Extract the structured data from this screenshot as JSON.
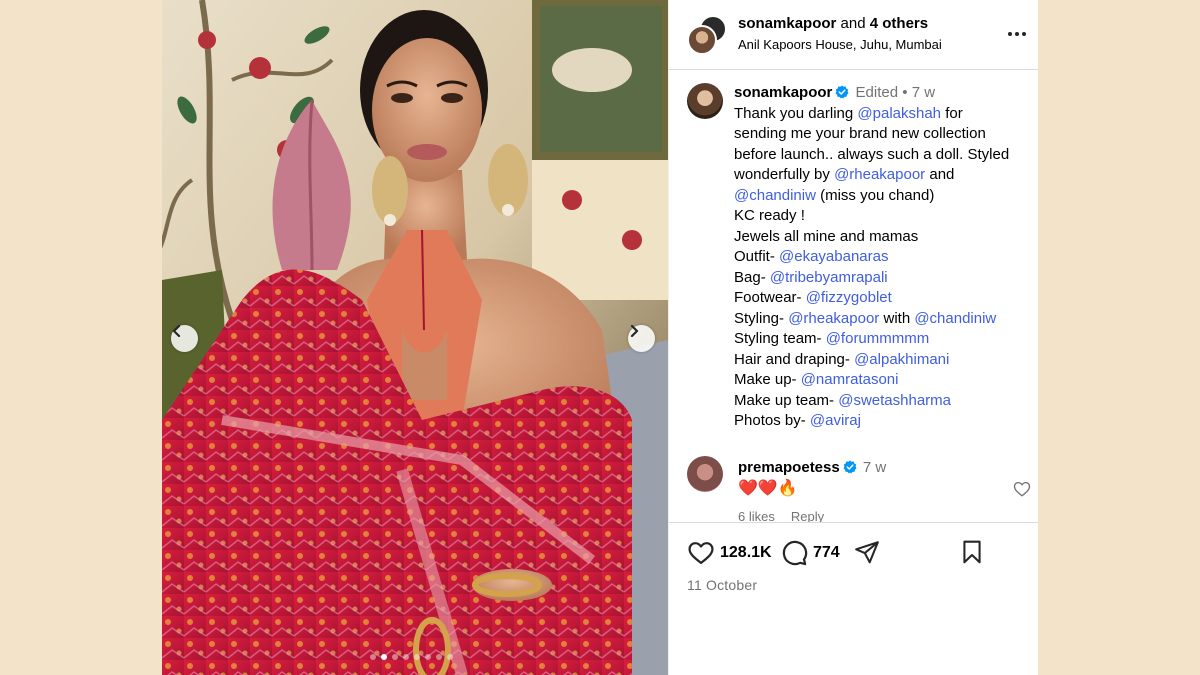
{
  "header": {
    "username": "sonamkapoor",
    "connector": " and ",
    "others": "4 others",
    "location": "Anil Kapoors House, Juhu, Mumbai"
  },
  "caption": {
    "username": "sonamkapoor",
    "edited": "Edited",
    "separator": "•",
    "time": "7 w",
    "lines": [
      [
        {
          "t": "Thank you darling "
        },
        {
          "t": "@palakshah",
          "m": true
        },
        {
          "t": " for"
        }
      ],
      [
        {
          "t": "sending me your brand new collection"
        }
      ],
      [
        {
          "t": "before launch.. always such a doll. Styled"
        }
      ],
      [
        {
          "t": "wonderfully by "
        },
        {
          "t": "@rheakapoor",
          "m": true
        },
        {
          "t": " and"
        }
      ],
      [
        {
          "t": "@chandiniw",
          "m": true
        },
        {
          "t": " (miss you chand)"
        }
      ],
      [
        {
          "t": "KC ready !"
        }
      ],
      [
        {
          "t": "Jewels all mine and mamas"
        }
      ],
      [
        {
          "t": "Outfit- "
        },
        {
          "t": "@ekayabanaras",
          "m": true
        }
      ],
      [
        {
          "t": "Bag- "
        },
        {
          "t": "@tribebyamrapali",
          "m": true
        }
      ],
      [
        {
          "t": "Footwear- "
        },
        {
          "t": "@fizzygoblet",
          "m": true
        }
      ],
      [
        {
          "t": "Styling- "
        },
        {
          "t": "@rheakapoor",
          "m": true
        },
        {
          "t": " with "
        },
        {
          "t": "@chandiniw",
          "m": true
        }
      ],
      [
        {
          "t": "Styling team- "
        },
        {
          "t": "@forummmmm",
          "m": true
        }
      ],
      [
        {
          "t": "Hair and draping- "
        },
        {
          "t": "@alpakhimani",
          "m": true
        }
      ],
      [
        {
          "t": "Make up- "
        },
        {
          "t": "@namratasoni",
          "m": true
        }
      ],
      [
        {
          "t": "Make up team- "
        },
        {
          "t": "@swetashharma",
          "m": true
        }
      ],
      [
        {
          "t": "Photos by- "
        },
        {
          "t": "@aviraj",
          "m": true
        }
      ]
    ]
  },
  "comment": {
    "username": "premapoetess",
    "time": "7 w",
    "text": "❤️❤️🔥",
    "likes": "6 likes",
    "reply": "Reply"
  },
  "actions": {
    "likes": "128.1K",
    "comments": "774"
  },
  "date": "11 October",
  "carousel": {
    "count": 8,
    "active_index": 1
  },
  "colors": {
    "mention": "#3f5ee0",
    "verified": "#0095f6",
    "background": "#f3e3c8"
  }
}
